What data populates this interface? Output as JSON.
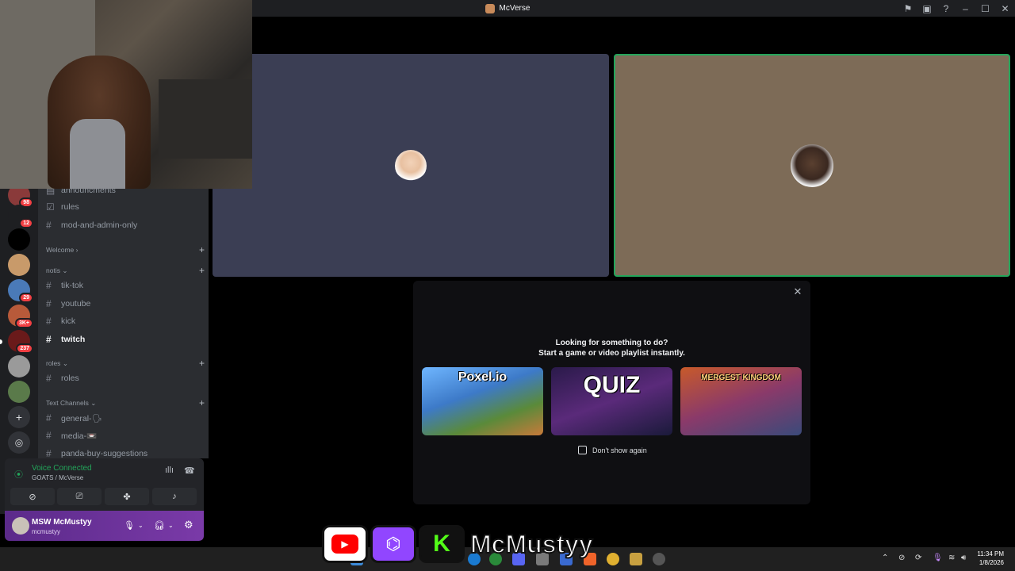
{
  "window": {
    "title": "McVerse"
  },
  "icons": {
    "title_bar": [
      "flag-icon",
      "inbox-icon",
      "help-icon",
      "minimize-icon",
      "maximize-icon",
      "close-icon"
    ]
  },
  "servers": [
    {
      "name": "server-1",
      "badge": "98",
      "color": "#8a3a3a"
    },
    {
      "name": "server-2",
      "badge": "12",
      "color": "#1e1f22"
    },
    {
      "name": "server-3",
      "badge": "",
      "color": "#000000"
    },
    {
      "name": "server-4",
      "badge": "",
      "color": "#c89a6a"
    },
    {
      "name": "server-5",
      "badge": "29",
      "color": "#4a7ab8"
    },
    {
      "name": "server-6",
      "badge": "3K+",
      "color": "#b85a3a"
    },
    {
      "name": "server-7",
      "badge": "237",
      "color": "#6a1a1a"
    },
    {
      "name": "server-8",
      "badge": "",
      "color": "#9a9a9a"
    },
    {
      "name": "server-9",
      "badge": "",
      "color": "#5a7a4a"
    }
  ],
  "channels": {
    "top": [
      {
        "name": "announcments",
        "icon": "megaphone-icon"
      },
      {
        "name": "rules",
        "icon": "checklist-icon"
      },
      {
        "name": "mod-and-admin-only",
        "icon": "hash-icon"
      }
    ],
    "categories": [
      {
        "label": "Welcome",
        "arrow": "›"
      },
      {
        "label": "notis",
        "arrow": "⌄"
      },
      {
        "label": "roles",
        "arrow": "⌄"
      },
      {
        "label": "Text Channels",
        "arrow": "⌄"
      }
    ],
    "notis": [
      "tik-tok",
      "youtube",
      "kick",
      "twitch"
    ],
    "roles": [
      "roles"
    ],
    "text": [
      "general-🗣",
      "media-📼",
      "panda-buy-suggestions"
    ]
  },
  "voice": {
    "status": "Voice Connected",
    "location": "GOATS / McVerse"
  },
  "user": {
    "display_name": "MSW McMustyy",
    "handle": "mcmustyy"
  },
  "activity": {
    "line1": "Looking for something to do?",
    "line2": "Start a game or video playlist instantly.",
    "games": [
      {
        "title": "Poxel.io"
      },
      {
        "title": "QUIZ"
      },
      {
        "title": "MERGEST KINGDOM"
      }
    ],
    "dont_show": "Don't show again"
  },
  "branding": {
    "name": "McMustyy"
  },
  "clock": {
    "time": "11:34 PM",
    "date": "1/8/2026"
  }
}
